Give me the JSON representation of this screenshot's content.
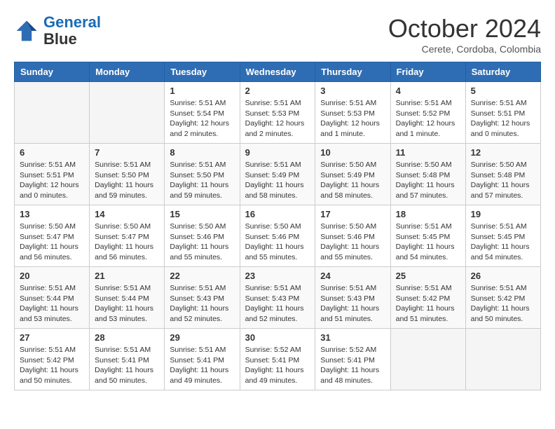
{
  "header": {
    "logo_line1": "General",
    "logo_line2": "Blue",
    "month": "October 2024",
    "location": "Cerete, Cordoba, Colombia"
  },
  "weekdays": [
    "Sunday",
    "Monday",
    "Tuesday",
    "Wednesday",
    "Thursday",
    "Friday",
    "Saturday"
  ],
  "weeks": [
    [
      {
        "day": "",
        "content": ""
      },
      {
        "day": "",
        "content": ""
      },
      {
        "day": "1",
        "content": "Sunrise: 5:51 AM\nSunset: 5:54 PM\nDaylight: 12 hours\nand 2 minutes."
      },
      {
        "day": "2",
        "content": "Sunrise: 5:51 AM\nSunset: 5:53 PM\nDaylight: 12 hours\nand 2 minutes."
      },
      {
        "day": "3",
        "content": "Sunrise: 5:51 AM\nSunset: 5:53 PM\nDaylight: 12 hours\nand 1 minute."
      },
      {
        "day": "4",
        "content": "Sunrise: 5:51 AM\nSunset: 5:52 PM\nDaylight: 12 hours\nand 1 minute."
      },
      {
        "day": "5",
        "content": "Sunrise: 5:51 AM\nSunset: 5:51 PM\nDaylight: 12 hours\nand 0 minutes."
      }
    ],
    [
      {
        "day": "6",
        "content": "Sunrise: 5:51 AM\nSunset: 5:51 PM\nDaylight: 12 hours\nand 0 minutes."
      },
      {
        "day": "7",
        "content": "Sunrise: 5:51 AM\nSunset: 5:50 PM\nDaylight: 11 hours\nand 59 minutes."
      },
      {
        "day": "8",
        "content": "Sunrise: 5:51 AM\nSunset: 5:50 PM\nDaylight: 11 hours\nand 59 minutes."
      },
      {
        "day": "9",
        "content": "Sunrise: 5:51 AM\nSunset: 5:49 PM\nDaylight: 11 hours\nand 58 minutes."
      },
      {
        "day": "10",
        "content": "Sunrise: 5:50 AM\nSunset: 5:49 PM\nDaylight: 11 hours\nand 58 minutes."
      },
      {
        "day": "11",
        "content": "Sunrise: 5:50 AM\nSunset: 5:48 PM\nDaylight: 11 hours\nand 57 minutes."
      },
      {
        "day": "12",
        "content": "Sunrise: 5:50 AM\nSunset: 5:48 PM\nDaylight: 11 hours\nand 57 minutes."
      }
    ],
    [
      {
        "day": "13",
        "content": "Sunrise: 5:50 AM\nSunset: 5:47 PM\nDaylight: 11 hours\nand 56 minutes."
      },
      {
        "day": "14",
        "content": "Sunrise: 5:50 AM\nSunset: 5:47 PM\nDaylight: 11 hours\nand 56 minutes."
      },
      {
        "day": "15",
        "content": "Sunrise: 5:50 AM\nSunset: 5:46 PM\nDaylight: 11 hours\nand 55 minutes."
      },
      {
        "day": "16",
        "content": "Sunrise: 5:50 AM\nSunset: 5:46 PM\nDaylight: 11 hours\nand 55 minutes."
      },
      {
        "day": "17",
        "content": "Sunrise: 5:50 AM\nSunset: 5:46 PM\nDaylight: 11 hours\nand 55 minutes."
      },
      {
        "day": "18",
        "content": "Sunrise: 5:51 AM\nSunset: 5:45 PM\nDaylight: 11 hours\nand 54 minutes."
      },
      {
        "day": "19",
        "content": "Sunrise: 5:51 AM\nSunset: 5:45 PM\nDaylight: 11 hours\nand 54 minutes."
      }
    ],
    [
      {
        "day": "20",
        "content": "Sunrise: 5:51 AM\nSunset: 5:44 PM\nDaylight: 11 hours\nand 53 minutes."
      },
      {
        "day": "21",
        "content": "Sunrise: 5:51 AM\nSunset: 5:44 PM\nDaylight: 11 hours\nand 53 minutes."
      },
      {
        "day": "22",
        "content": "Sunrise: 5:51 AM\nSunset: 5:43 PM\nDaylight: 11 hours\nand 52 minutes."
      },
      {
        "day": "23",
        "content": "Sunrise: 5:51 AM\nSunset: 5:43 PM\nDaylight: 11 hours\nand 52 minutes."
      },
      {
        "day": "24",
        "content": "Sunrise: 5:51 AM\nSunset: 5:43 PM\nDaylight: 11 hours\nand 51 minutes."
      },
      {
        "day": "25",
        "content": "Sunrise: 5:51 AM\nSunset: 5:42 PM\nDaylight: 11 hours\nand 51 minutes."
      },
      {
        "day": "26",
        "content": "Sunrise: 5:51 AM\nSunset: 5:42 PM\nDaylight: 11 hours\nand 50 minutes."
      }
    ],
    [
      {
        "day": "27",
        "content": "Sunrise: 5:51 AM\nSunset: 5:42 PM\nDaylight: 11 hours\nand 50 minutes."
      },
      {
        "day": "28",
        "content": "Sunrise: 5:51 AM\nSunset: 5:41 PM\nDaylight: 11 hours\nand 50 minutes."
      },
      {
        "day": "29",
        "content": "Sunrise: 5:51 AM\nSunset: 5:41 PM\nDaylight: 11 hours\nand 49 minutes."
      },
      {
        "day": "30",
        "content": "Sunrise: 5:52 AM\nSunset: 5:41 PM\nDaylight: 11 hours\nand 49 minutes."
      },
      {
        "day": "31",
        "content": "Sunrise: 5:52 AM\nSunset: 5:41 PM\nDaylight: 11 hours\nand 48 minutes."
      },
      {
        "day": "",
        "content": ""
      },
      {
        "day": "",
        "content": ""
      }
    ]
  ]
}
